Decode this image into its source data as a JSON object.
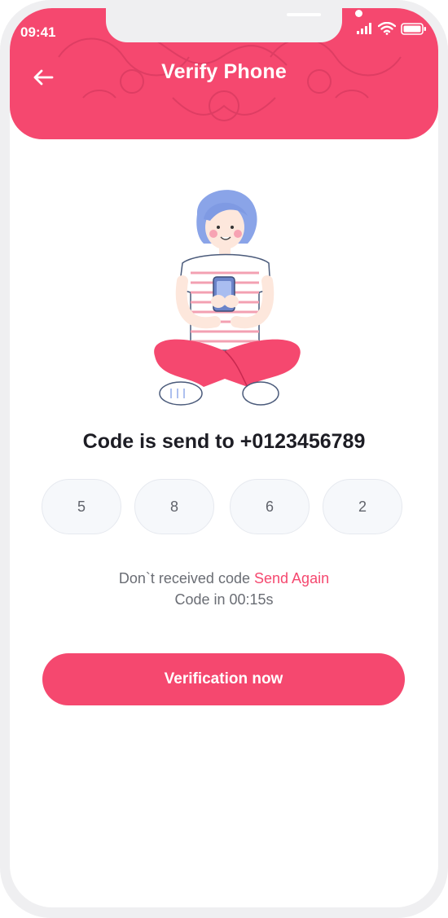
{
  "status_bar": {
    "time": "09:41"
  },
  "header": {
    "title": "Verify Phone"
  },
  "code_heading": "Code is send to +0123456789",
  "otp_digits": [
    "5",
    "8",
    "6",
    "2"
  ],
  "resend": {
    "prefix": "Don`t received code",
    "link": "Send Again"
  },
  "timer": "Code in 00:15s",
  "verify_button": "Verification now",
  "colors": {
    "accent": "#f5486f",
    "frame": "#efeff1",
    "input_bg": "#f6f8fb"
  },
  "icons": [
    "back-arrow-icon",
    "signal-icon",
    "wifi-icon",
    "battery-icon"
  ]
}
